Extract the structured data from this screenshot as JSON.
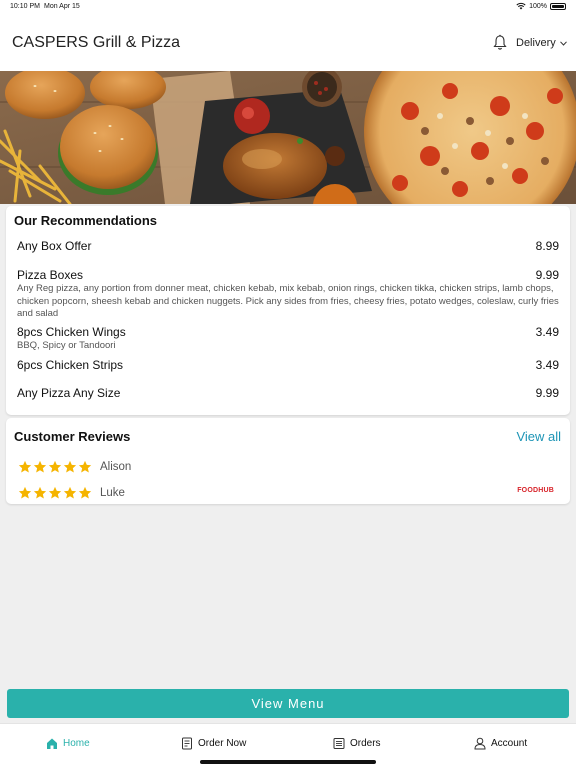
{
  "status": {
    "time": "10:10 PM",
    "date": "Mon Apr 15",
    "battery": "100%"
  },
  "header": {
    "title": "CASPERS Grill & Pizza",
    "mode": "Delivery"
  },
  "recommendations": {
    "title": "Our Recommendations",
    "items": [
      {
        "name": "Any Box Offer",
        "price": "8.99",
        "description": ""
      },
      {
        "name": "Pizza Boxes",
        "price": "9.99",
        "description": "Any Reg pizza, any portion from donner meat, chicken kebab, mix kebab, onion rings, chicken tikka, chicken strips, lamb chops, chicken popcorn, sheesh kebab and chicken nuggets. Pick any sides from fries, cheesy fries, potato wedges, coleslaw, curly fries and salad"
      },
      {
        "name": "8pcs Chicken Wings",
        "price": "3.49",
        "description": "BBQ, Spicy or Tandoori"
      },
      {
        "name": "6pcs Chicken Strips",
        "price": "3.49",
        "description": ""
      },
      {
        "name": "Any Pizza Any Size",
        "price": "9.99",
        "description": ""
      }
    ]
  },
  "reviews": {
    "title": "Customer Reviews",
    "view_all": "View all",
    "items": [
      {
        "name": "Alison",
        "rating": 5
      },
      {
        "name": "Luke",
        "rating": 5
      }
    ],
    "provider_logo": "FOODHUB"
  },
  "view_menu_label": "View Menu",
  "tabs": [
    {
      "label": "Home",
      "icon": "home-icon",
      "active": true
    },
    {
      "label": "Order Now",
      "icon": "order-icon",
      "active": false
    },
    {
      "label": "Orders",
      "icon": "receipt-icon",
      "active": false
    },
    {
      "label": "Account",
      "icon": "user-icon",
      "active": false
    }
  ],
  "colors": {
    "accent": "#2ab1ab",
    "link": "#1e95b6",
    "star": "#f5b400",
    "brand_red": "#d8232a"
  }
}
